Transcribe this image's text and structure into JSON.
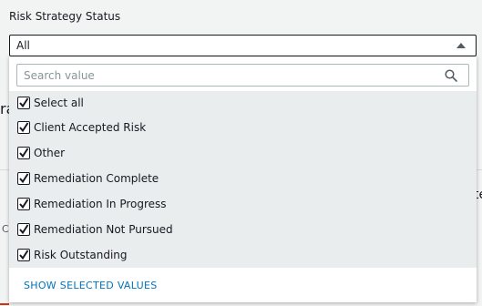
{
  "field": {
    "label": "Risk Strategy Status",
    "selected_value": "All"
  },
  "background": {
    "fragment_left": "ra",
    "fragment_right": "te",
    "fragment_small": "C"
  },
  "dropdown": {
    "search_placeholder": "Search value",
    "options": [
      {
        "label": "Select all",
        "checked": true
      },
      {
        "label": "Client Accepted Risk",
        "checked": true
      },
      {
        "label": "Other",
        "checked": true
      },
      {
        "label": "Remediation Complete",
        "checked": true
      },
      {
        "label": "Remediation In Progress",
        "checked": true
      },
      {
        "label": "Remediation Not Pursued",
        "checked": true
      },
      {
        "label": "Risk Outstanding",
        "checked": true
      }
    ],
    "footer_action": "SHOW SELECTED VALUES"
  },
  "colors": {
    "accent_link": "#0073bb",
    "options_background": "#eaeded",
    "page_background": "#f2f3f3"
  }
}
